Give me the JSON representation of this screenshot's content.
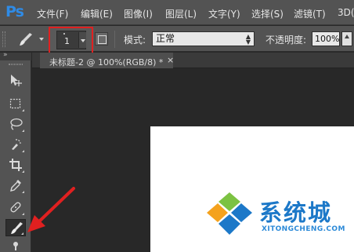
{
  "app": {
    "logo": "Ps"
  },
  "menu": {
    "items": [
      "文件(F)",
      "编辑(E)",
      "图像(I)",
      "图层(L)",
      "文字(Y)",
      "选择(S)",
      "滤镜(T)",
      "3D("
    ]
  },
  "options": {
    "brush_size": "1",
    "mode_label": "模式:",
    "mode_value": "正常",
    "opacity_label": "不透明度:",
    "opacity_value": "100%"
  },
  "document": {
    "tab_title": "未标题-2 @ 100%(RGB/8) *",
    "close": "×"
  },
  "watermark": {
    "text": "系统城",
    "url": "XITONGCHENG.COM"
  },
  "colors": {
    "highlight": "#e02020",
    "logo": "#2f8be6",
    "watermark": "#1c78c8"
  },
  "toolbox": {
    "tools": [
      "move-tool",
      "marquee-tool",
      "lasso-tool",
      "quick-selection-tool",
      "crop-tool",
      "eyedropper-tool",
      "healing-brush-tool",
      "brush-tool",
      "clone-stamp-tool"
    ],
    "active_tool": "brush-tool"
  }
}
